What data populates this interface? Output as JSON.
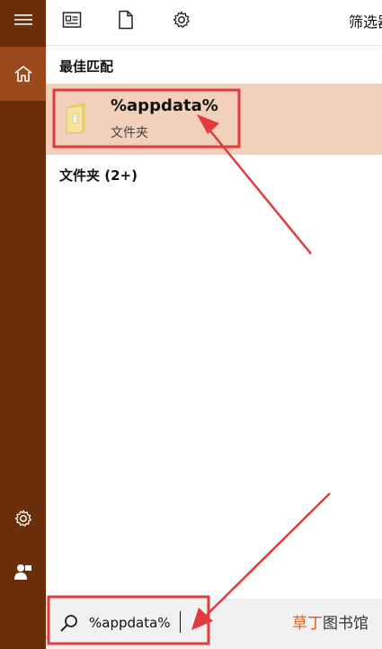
{
  "toolbar": {
    "filter_label": "筛选器",
    "icons": [
      "document-icon",
      "file-icon",
      "gear-icon"
    ]
  },
  "sidebar": {
    "icons": [
      "hamburger-icon",
      "home-icon",
      "settings-icon",
      "user-icon"
    ]
  },
  "best_match": {
    "section_label": "最佳匹配",
    "title": "%appdata%",
    "subtitle": "文件夹"
  },
  "folders": {
    "section_label": "文件夹 (2+)"
  },
  "search": {
    "value": "%appdata%"
  },
  "watermark": {
    "accent": "草丁",
    "rest": "图书馆"
  },
  "colors": {
    "sidebar": "#6b2e0a",
    "sidebar_active": "#9a4a1c",
    "highlight": "#f2d0bb",
    "annotation": "#e23b3b"
  }
}
